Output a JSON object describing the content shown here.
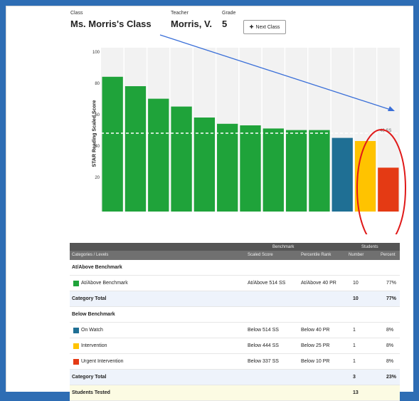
{
  "header": {
    "class_label": "Class",
    "class_value": "Ms. Morris's Class",
    "teacher_label": "Teacher",
    "teacher_value": "Morris, V.",
    "grade_label": "Grade",
    "grade_value": "5",
    "next_class_label": "Next Class"
  },
  "chart": {
    "ylabel": "STAR Reading Scaled Score",
    "yticks": [
      "100",
      "80",
      "60",
      "40",
      "20"
    ],
    "benchmark_label": "40 SS"
  },
  "chart_data": {
    "type": "bar",
    "ylabel": "STAR Reading Scaled Score",
    "ylim": [
      0,
      100
    ],
    "grid": true,
    "legend": "none",
    "values": [
      86,
      80,
      72,
      67,
      60,
      56,
      55,
      53,
      52,
      52,
      47,
      45,
      28
    ],
    "colors": [
      "#1fa33a",
      "#1fa33a",
      "#1fa33a",
      "#1fa33a",
      "#1fa33a",
      "#1fa33a",
      "#1fa33a",
      "#1fa33a",
      "#1fa33a",
      "#1fa33a",
      "#1f6f94",
      "#ffc300",
      "#e43a14"
    ],
    "benchmark_line": 50
  },
  "table": {
    "group_headers": {
      "benchmark": "Benchmark",
      "students": "Students"
    },
    "columns": [
      "Categories / Levels",
      "Scaled Score",
      "Percentile Rank",
      "Number",
      "Percent"
    ],
    "rows": [
      {
        "kind": "section",
        "label": "At/Above Benchmark"
      },
      {
        "kind": "item",
        "color": "#1fa33a",
        "label": "At/Above Benchmark",
        "ss": "At/Above 514 SS",
        "pr": "At/Above 40 PR",
        "num": "10",
        "pct": "77%"
      },
      {
        "kind": "total",
        "label": "Category Total",
        "ss": "",
        "pr": "",
        "num": "10",
        "pct": "77%"
      },
      {
        "kind": "section",
        "label": "Below Benchmark"
      },
      {
        "kind": "item",
        "color": "#1f6f94",
        "label": "On Watch",
        "ss": "Below 514 SS",
        "pr": "Below 40 PR",
        "num": "1",
        "pct": "8%"
      },
      {
        "kind": "item",
        "color": "#ffc300",
        "label": "Intervention",
        "ss": "Below 444 SS",
        "pr": "Below 25 PR",
        "num": "1",
        "pct": "8%"
      },
      {
        "kind": "item",
        "color": "#e43a14",
        "label": "Urgent Intervention",
        "ss": "Below 337 SS",
        "pr": "Below 10 PR",
        "num": "1",
        "pct": "8%"
      },
      {
        "kind": "total",
        "label": "Category Total",
        "ss": "",
        "pr": "",
        "num": "3",
        "pct": "23%"
      },
      {
        "kind": "students",
        "label": "Students Tested",
        "ss": "",
        "pr": "",
        "num": "13",
        "pct": ""
      }
    ]
  },
  "annotation": {
    "arrow_color": "#3a6fd8",
    "circle_color": "#e01919"
  }
}
